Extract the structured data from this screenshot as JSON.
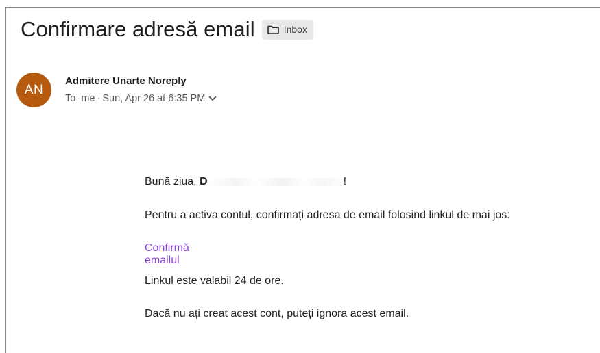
{
  "email": {
    "subject": "Confirmare adresă email",
    "label": {
      "text": "Inbox",
      "icon": "folder-icon"
    },
    "sender": {
      "initials": "AN",
      "name": "Admitere Unarte Noreply",
      "avatar_color": "#b55a0e"
    },
    "meta": {
      "to": "To: me",
      "separator": "·",
      "date": "Sun, Apr 26 at 6:35 PM",
      "expand_icon": "chevron-down-icon"
    },
    "body": {
      "greeting_prefix": "Bună ziua, ",
      "greeting_name": "D",
      "greeting_suffix": "!",
      "intro": "Pentru a activa contul, confirmați adresa de email folosind linkul de mai jos:",
      "confirm_link": "Confirmă emailul",
      "validity": "Linkul este valabil 24 de ore.",
      "ignore_notice": "Dacă nu ați creat acest cont, puteți ignora acest email."
    }
  },
  "colors": {
    "link": "#8e44d8",
    "chip_background": "#e8e8e8",
    "text": "#1f1f1f",
    "secondary_text": "#5a5a5a"
  }
}
